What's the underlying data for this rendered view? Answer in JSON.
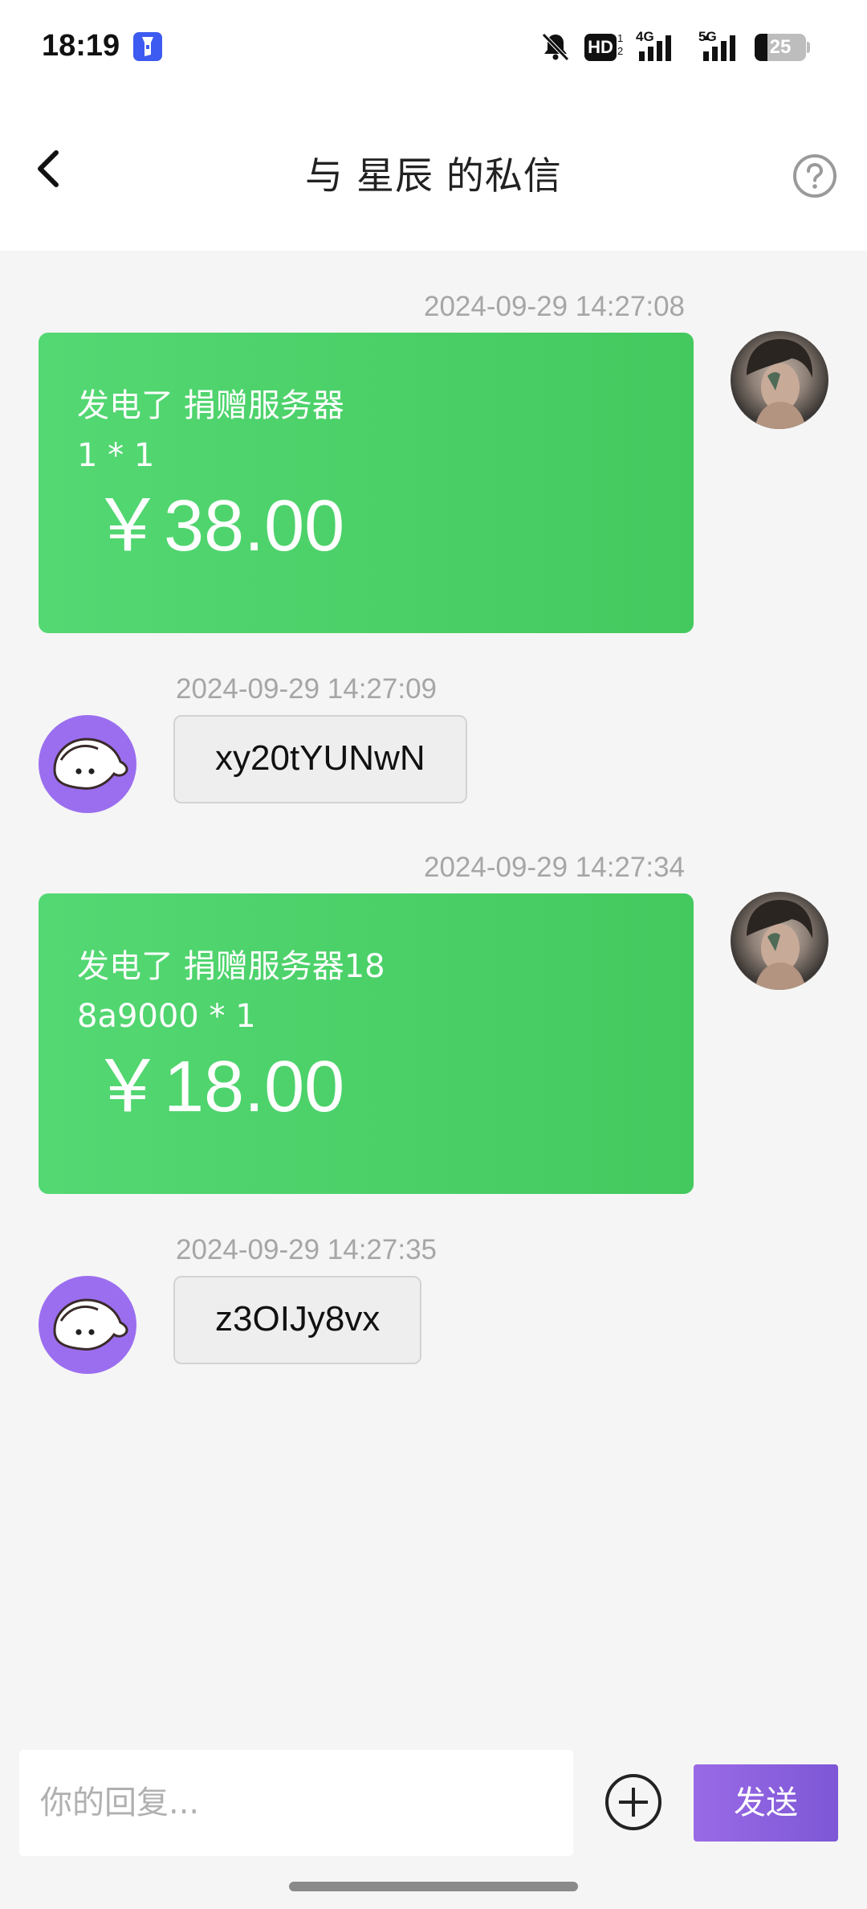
{
  "status_bar": {
    "time": "18:19",
    "hd_label": "HD",
    "hd_sub": "1\n2",
    "net1": "4G",
    "net2": "5G",
    "battery": "25",
    "battery_level_percent": 25,
    "icons": [
      "flashlight-icon",
      "bell-off-icon",
      "signal-icon",
      "signal-icon",
      "battery-icon"
    ]
  },
  "header": {
    "title": "与 星辰 的私信",
    "back_icon": "chevron-left-icon",
    "help_icon": "question-circle-icon"
  },
  "messages": [
    {
      "side": "right",
      "type": "gift",
      "timestamp": "2024-09-29 14:27:08",
      "line1": "发电了 捐赠服务器",
      "line2": "1 * 1",
      "amount": "￥38.00"
    },
    {
      "side": "left",
      "type": "text",
      "timestamp": "2024-09-29 14:27:09",
      "text": "xy20tYUNwN"
    },
    {
      "side": "right",
      "type": "gift",
      "timestamp": "2024-09-29 14:27:34",
      "line1": "发电了 捐赠服务器18",
      "line2": "8a9000 * 1",
      "amount": "￥18.00"
    },
    {
      "side": "left",
      "type": "text",
      "timestamp": "2024-09-29 14:27:35",
      "text": "z3OIJy8vx"
    }
  ],
  "composer": {
    "placeholder": "你的回复...",
    "value": "",
    "add_icon": "plus-circle-icon",
    "send_label": "发送"
  },
  "colors": {
    "gift_card": "#4cd068",
    "send_button": "#8a5fdf",
    "bot_avatar": "#9b6ef0"
  }
}
